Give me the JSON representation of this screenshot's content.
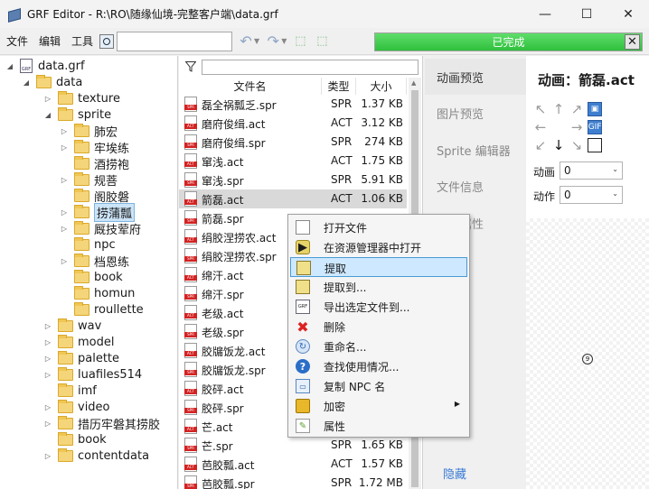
{
  "window": {
    "title": "GRF Editor - R:\\RO\\随缘仙境-完整客户端\\data.grf",
    "minimize": "—",
    "maximize": "☐",
    "close": "✕"
  },
  "toolbar": {
    "menu": [
      "文件",
      "编辑",
      "工具"
    ],
    "search_value": "",
    "progress_text": "已完成",
    "progress_value": 1.0,
    "progress_close": "✕"
  },
  "tree": [
    {
      "label": "data.grf",
      "icon": "grf-file",
      "expander": "◢",
      "level": 0
    },
    {
      "label": "data",
      "icon": "folder",
      "expander": "◢",
      "level": 1
    },
    {
      "label": "texture",
      "icon": "folder",
      "expander": "▷",
      "level": 2
    },
    {
      "label": "sprite",
      "icon": "folder",
      "expander": "◢",
      "level": 2
    },
    {
      "label": "肺宏",
      "icon": "folder",
      "expander": "▷",
      "level": 3
    },
    {
      "label": "牢埃练",
      "icon": "folder",
      "expander": "▷",
      "level": 3
    },
    {
      "label": "酒捞袍",
      "icon": "folder",
      "expander": "",
      "level": 3
    },
    {
      "label": "规菩",
      "icon": "folder",
      "expander": "▷",
      "level": 3
    },
    {
      "label": "阁胶磐",
      "icon": "folder",
      "expander": "",
      "level": 3
    },
    {
      "label": "捞蒲瓢",
      "icon": "folder",
      "expander": "▷",
      "level": 3,
      "selected": true
    },
    {
      "label": "厩技荤府",
      "icon": "folder",
      "expander": "▷",
      "level": 3
    },
    {
      "label": "npc",
      "icon": "folder",
      "expander": "",
      "level": 3
    },
    {
      "label": "档恩练",
      "icon": "folder",
      "expander": "▷",
      "level": 3
    },
    {
      "label": "book",
      "icon": "folder",
      "expander": "",
      "level": 3
    },
    {
      "label": "homun",
      "icon": "folder",
      "expander": "",
      "level": 3
    },
    {
      "label": "roullette",
      "icon": "folder",
      "expander": "",
      "level": 3
    },
    {
      "label": "wav",
      "icon": "folder",
      "expander": "▷",
      "level": 2
    },
    {
      "label": "model",
      "icon": "folder",
      "expander": "▷",
      "level": 2
    },
    {
      "label": "palette",
      "icon": "folder",
      "expander": "▷",
      "level": 2
    },
    {
      "label": "luafiles514",
      "icon": "folder",
      "expander": "▷",
      "level": 2
    },
    {
      "label": "imf",
      "icon": "folder",
      "expander": "",
      "level": 2
    },
    {
      "label": "video",
      "icon": "folder",
      "expander": "▷",
      "level": 2
    },
    {
      "label": "措历牢磐其捞胶",
      "icon": "folder",
      "expander": "▷",
      "level": 2
    },
    {
      "label": "book",
      "icon": "folder",
      "expander": "",
      "level": 2
    },
    {
      "label": "contentdata",
      "icon": "folder",
      "expander": "▷",
      "level": 2
    }
  ],
  "filelist": {
    "columns": [
      "文件名",
      "类型",
      "大小"
    ],
    "filter_value": "",
    "rows": [
      {
        "name": "磊全祸瓢乏.spr",
        "type": "SPR",
        "size": "1.37 KB"
      },
      {
        "name": "磨府俊缉.act",
        "type": "ACT",
        "size": "3.12 KB"
      },
      {
        "name": "磨府俊缉.spr",
        "type": "SPR",
        "size": "274 KB"
      },
      {
        "name": "窜浅.act",
        "type": "ACT",
        "size": "1.75 KB"
      },
      {
        "name": "窜浅.spr",
        "type": "SPR",
        "size": "5.91 KB"
      },
      {
        "name": "箭磊.act",
        "type": "ACT",
        "size": "1.06 KB",
        "selected": true
      },
      {
        "name": "箭磊.spr",
        "type": "",
        "size": ""
      },
      {
        "name": "绢胶涅捞农.act",
        "type": "",
        "size": ""
      },
      {
        "name": "绢胶涅捞农.spr",
        "type": "",
        "size": ""
      },
      {
        "name": "绵汗.act",
        "type": "",
        "size": ""
      },
      {
        "name": "绵汗.spr",
        "type": "",
        "size": ""
      },
      {
        "name": "老级.act",
        "type": "",
        "size": ""
      },
      {
        "name": "老级.spr",
        "type": "",
        "size": ""
      },
      {
        "name": "胶牖饭龙.act",
        "type": "",
        "size": ""
      },
      {
        "name": "胶牖饭龙.spr",
        "type": "",
        "size": ""
      },
      {
        "name": "胶砰.act",
        "type": "",
        "size": ""
      },
      {
        "name": "胶砰.spr",
        "type": "",
        "size": ""
      },
      {
        "name": "芒.act",
        "type": "",
        "size": ""
      },
      {
        "name": "芒.spr",
        "type": "SPR",
        "size": "1.65 KB"
      },
      {
        "name": "芭胶瓢.act",
        "type": "ACT",
        "size": "1.57 KB"
      },
      {
        "name": "芭胶瓢.spr",
        "type": "SPR",
        "size": "1.72 MB"
      }
    ]
  },
  "right_tabs": [
    "动画预览",
    "图片预览",
    "Sprite 编辑器",
    "文件信息",
    "项目属性"
  ],
  "hide_label": "隐藏",
  "preview": {
    "title": "动画：箭磊.act",
    "anim_label": "动画",
    "anim_value": "0",
    "action_label": "动作",
    "action_value": "0"
  },
  "context_menu": [
    {
      "label": "打开文件",
      "icon": "page-icon"
    },
    {
      "label": "在资源管理器中打开",
      "icon": "explorer-open-icon"
    },
    {
      "label": "提取",
      "icon": "extract-icon",
      "highlighted": true
    },
    {
      "label": "提取到...",
      "icon": "extract-to-icon"
    },
    {
      "label": "导出选定文件到...",
      "icon": "grf-export-icon"
    },
    {
      "label": "删除",
      "icon": "delete-icon"
    },
    {
      "label": "重命名...",
      "icon": "rename-icon"
    },
    {
      "label": "查找使用情况...",
      "icon": "help-icon"
    },
    {
      "label": "复制 NPC 名",
      "icon": "copy-icon"
    },
    {
      "label": "加密",
      "icon": "lock-icon",
      "submenu": true
    },
    {
      "label": "属性",
      "icon": "properties-icon"
    }
  ]
}
